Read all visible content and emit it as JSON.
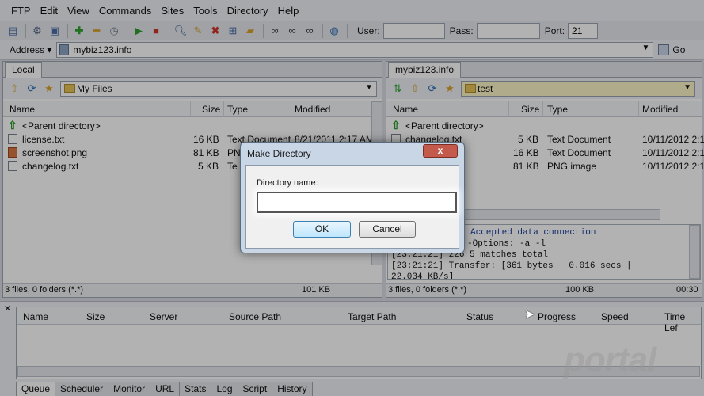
{
  "menu": [
    "FTP",
    "Edit",
    "View",
    "Commands",
    "Sites",
    "Tools",
    "Directory",
    "Help"
  ],
  "toolbar": {
    "user_label": "User:",
    "user_value": "",
    "pass_label": "Pass:",
    "pass_value": "",
    "port_label": "Port:",
    "port_value": "21",
    "icons": [
      "site-manager-icon",
      "settings-icon",
      "layout-icon",
      "add-icon",
      "remove-icon",
      "refresh-icon",
      "play-icon",
      "stop-icon",
      "search-icon",
      "edit-icon",
      "delete-icon",
      "rename-icon",
      "new-folder-icon",
      "binoculars-icon",
      "binoculars-icon",
      "binoculars-icon",
      "globe-icon"
    ]
  },
  "address": {
    "label": "Address",
    "value": "mybiz123.info",
    "go_label": "Go"
  },
  "left_pane": {
    "tab": "Local",
    "path": "My Files",
    "columns": [
      "Name",
      "Size",
      "Type",
      "Modified"
    ],
    "rows": [
      {
        "name": "<Parent directory>",
        "size": "",
        "type": "",
        "modified": "",
        "icon": "up-arrow-icon"
      },
      {
        "name": "license.txt",
        "size": "16 KB",
        "type": "Text Document",
        "modified": "8/21/2011 2:17 AM",
        "icon": "text-file-icon"
      },
      {
        "name": "screenshot.png",
        "size": "81 KB",
        "type": "PNG",
        "modified": "",
        "icon": "image-file-icon"
      },
      {
        "name": "changelog.txt",
        "size": "5 KB",
        "type": "Te",
        "modified": "",
        "icon": "text-file-icon"
      }
    ],
    "status_left": "3 files, 0 folders (*.*)",
    "status_size": "101 KB"
  },
  "right_pane": {
    "tab": "mybiz123.info",
    "path": "test",
    "columns": [
      "Name",
      "Size",
      "Type",
      "Modified"
    ],
    "rows": [
      {
        "name": "<Parent directory>",
        "size": "",
        "type": "",
        "modified": "",
        "icon": "up-arrow-icon"
      },
      {
        "name": "changelog.txt",
        "size": "5 KB",
        "type": "Text Document",
        "modified": "10/11/2012 2:1",
        "icon": "text-file-icon"
      },
      {
        "name": "",
        "size": "16 KB",
        "type": "Text Document",
        "modified": "10/11/2012 2:1",
        "icon": ""
      },
      {
        "name": "",
        "size": "81 KB",
        "type": "PNG image",
        "modified": "10/11/2012 2:1",
        "icon": ""
      }
    ],
    "status_left": "3 files, 0 folders (*.*)",
    "status_size": "100 KB",
    "status_time": "00:30"
  },
  "log": {
    "lines": [
      {
        "text": "Accepted data connection",
        "color": "blue"
      },
      {
        "text": "-Options: -a -l",
        "color": "normal"
      },
      {
        "text": "[23:21:21] 226 5 matches total",
        "color": "normal"
      },
      {
        "text": "[23:21:21] Transfer: [361 bytes | 0.016 secs |",
        "color": "normal"
      },
      {
        "text": "22.034 KB/s]",
        "color": "normal"
      }
    ]
  },
  "queue": {
    "columns": [
      "Name",
      "Size",
      "Server",
      "Source Path",
      "Target Path",
      "Status",
      "Progress",
      "Speed",
      "Time Lef"
    ],
    "tabs": [
      "Queue",
      "Scheduler",
      "Monitor",
      "URL",
      "Stats",
      "Log",
      "Script",
      "History"
    ],
    "active_tab": "Queue"
  },
  "dialog": {
    "title": "Make Directory",
    "close_label": "x",
    "field_label": "Directory name:",
    "field_value": "",
    "ok_label": "OK",
    "cancel_label": "Cancel"
  },
  "watermark": "portal",
  "colors": {
    "accent": "#3c7fb1",
    "close": "#c45a4b",
    "log_blue": "#1c3fa0"
  }
}
